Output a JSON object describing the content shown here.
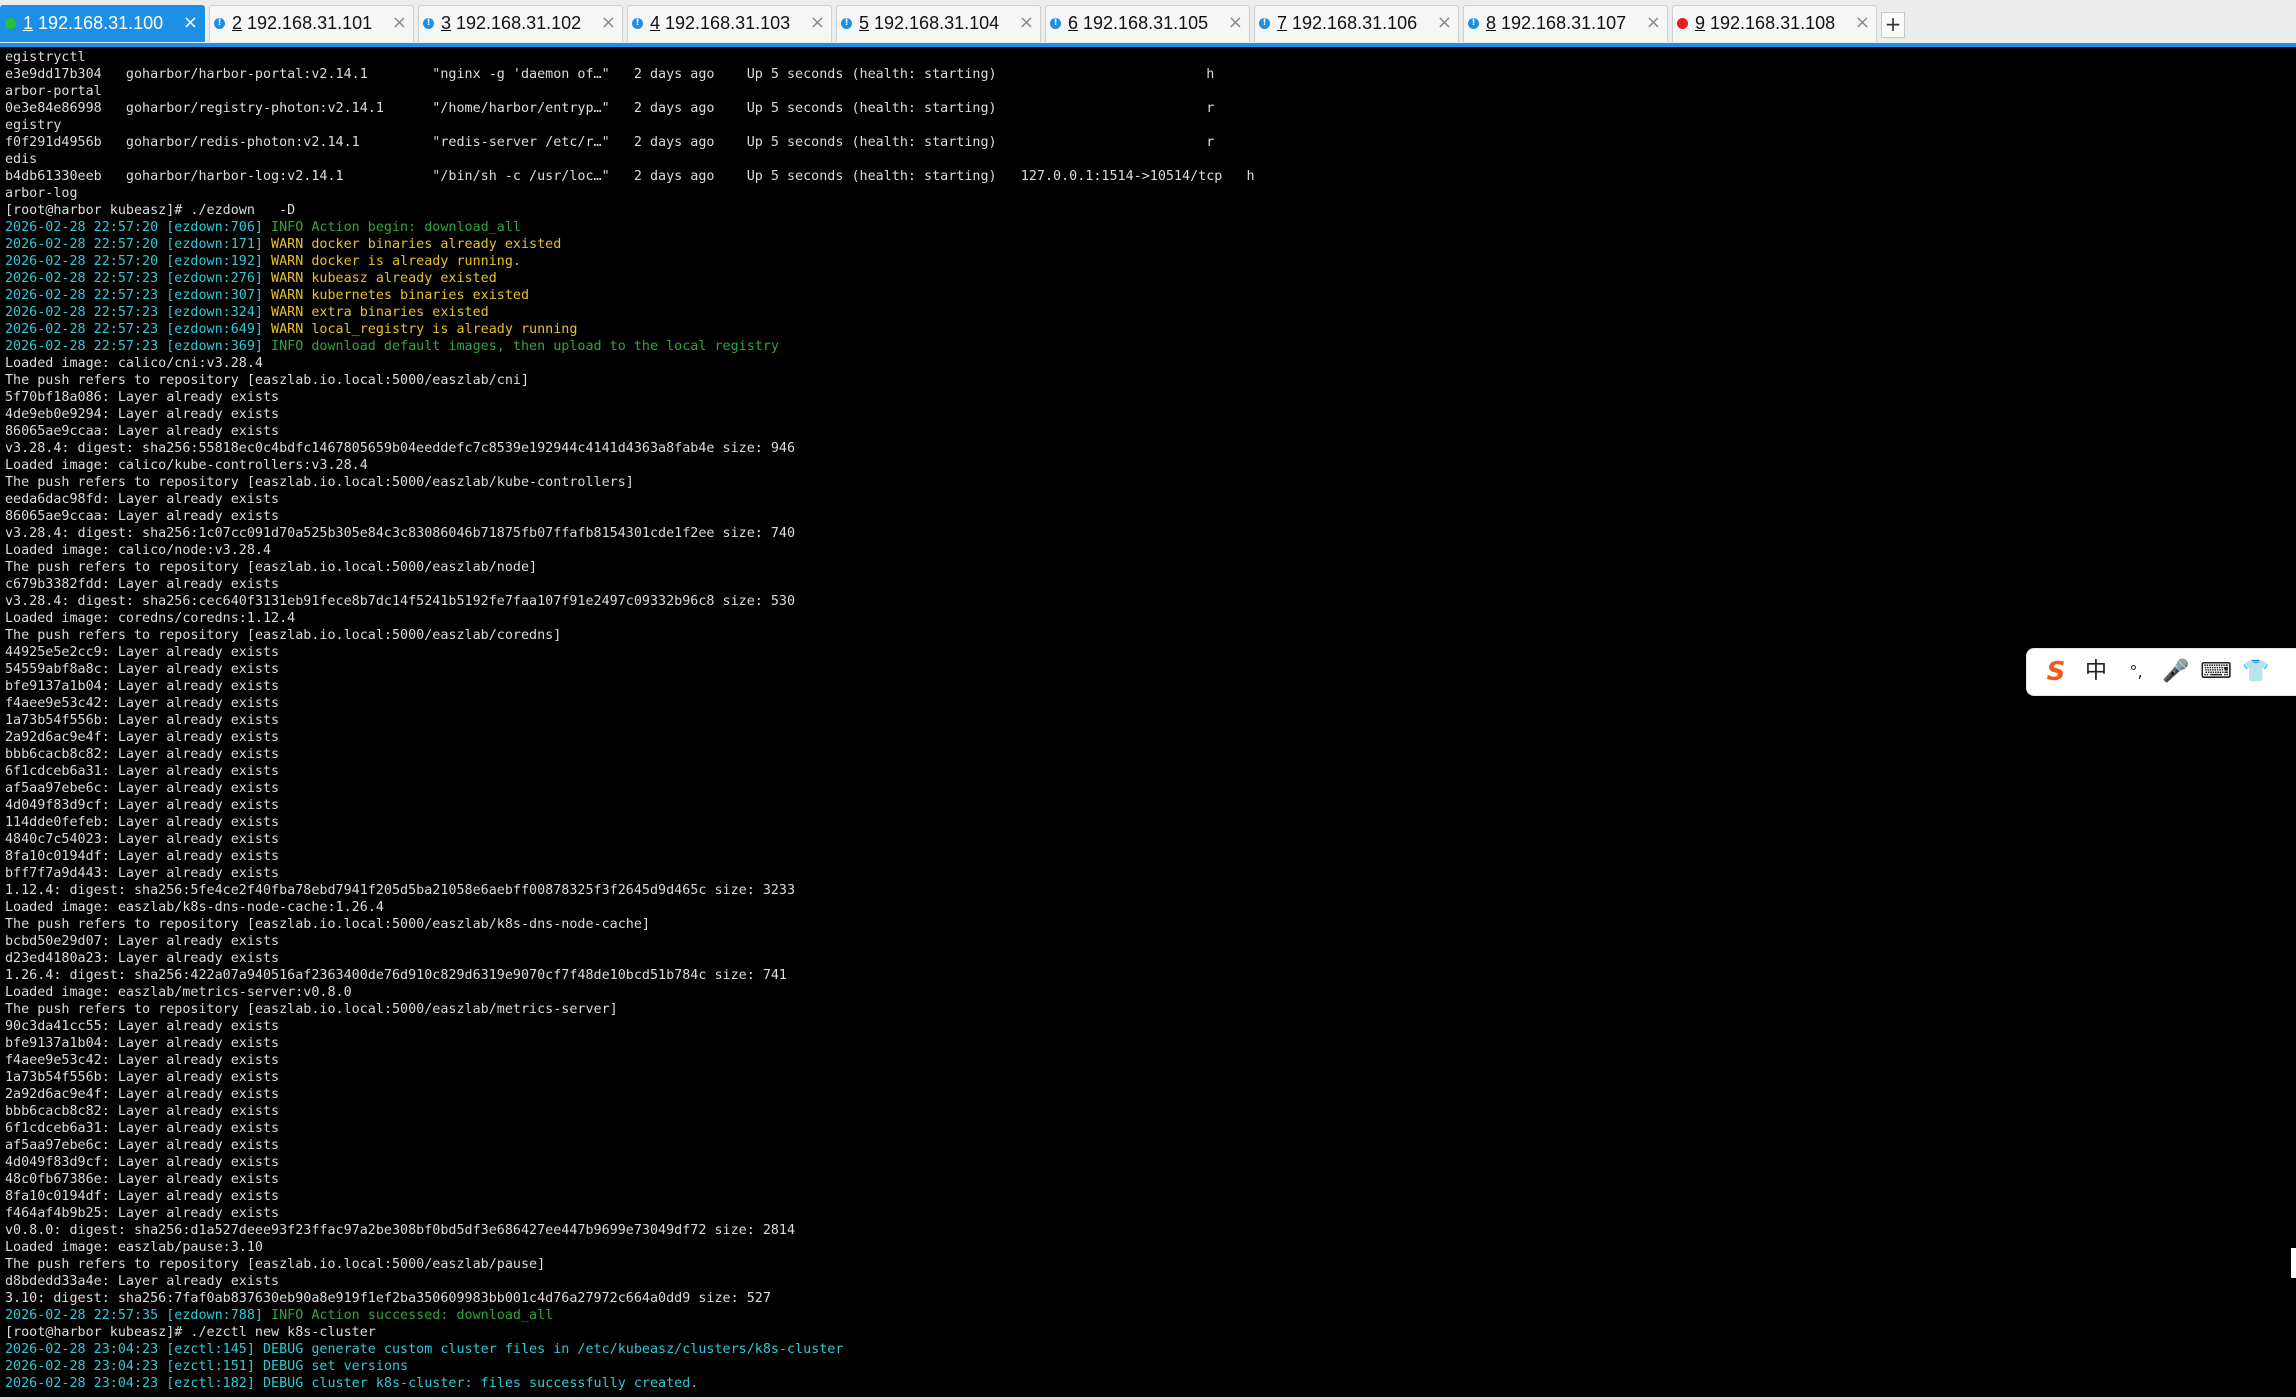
{
  "tabs": [
    {
      "num": "1",
      "host": "192.168.31.100",
      "status": "connected",
      "active": true
    },
    {
      "num": "2",
      "host": "192.168.31.101",
      "status": "warning",
      "active": false
    },
    {
      "num": "3",
      "host": "192.168.31.102",
      "status": "warning",
      "active": false
    },
    {
      "num": "4",
      "host": "192.168.31.103",
      "status": "warning",
      "active": false
    },
    {
      "num": "5",
      "host": "192.168.31.104",
      "status": "warning",
      "active": false
    },
    {
      "num": "6",
      "host": "192.168.31.105",
      "status": "warning",
      "active": false
    },
    {
      "num": "7",
      "host": "192.168.31.106",
      "status": "warning",
      "active": false
    },
    {
      "num": "8",
      "host": "192.168.31.107",
      "status": "warning",
      "active": false
    },
    {
      "num": "9",
      "host": "192.168.31.108",
      "status": "disconnected",
      "active": false
    }
  ],
  "tab_close_glyph": "×",
  "new_tab_glyph": "+",
  "colors": {
    "tab_active": "#1e8fe6",
    "status_connected": "#2ebd3b",
    "status_warning": "#1e8fe6",
    "status_disconnected": "#e02020",
    "terminal_bg": "#000000",
    "log_timestamp": "#2fc9d6",
    "log_info": "#2fa53a",
    "log_warn": "#e6c12a"
  },
  "terminal": {
    "lines": [
      [
        {
          "t": "egistryctl"
        }
      ],
      [
        {
          "t": "e3e9dd17b304   goharbor/harbor-portal:v2.14.1        \"nginx -g 'daemon of…\"   2 days ago    Up 5 seconds (health: starting)                          h"
        }
      ],
      [
        {
          "t": "arbor-portal"
        }
      ],
      [
        {
          "t": "0e3e84e86998   goharbor/registry-photon:v2.14.1      \"/home/harbor/entryp…\"   2 days ago    Up 5 seconds (health: starting)                          r"
        }
      ],
      [
        {
          "t": "egistry"
        }
      ],
      [
        {
          "t": "f0f291d4956b   goharbor/redis-photon:v2.14.1         \"redis-server /etc/r…\"   2 days ago    Up 5 seconds (health: starting)                          r"
        }
      ],
      [
        {
          "t": "edis"
        }
      ],
      [
        {
          "t": "b4db61330eeb   goharbor/harbor-log:v2.14.1           \"/bin/sh -c /usr/loc…\"   2 days ago    Up 5 seconds (health: starting)   127.0.0.1:1514->10514/tcp   h"
        }
      ],
      [
        {
          "t": "arbor-log"
        }
      ],
      [
        {
          "t": "[root@harbor kubeasz]# ./ezdown   -D"
        }
      ],
      [
        {
          "t": "2026-02-28 22:57:20 [ezdown:706] ",
          "c": "ts"
        },
        {
          "t": "INFO Action begin: download_all",
          "c": "info"
        }
      ],
      [
        {
          "t": "2026-02-28 22:57:20 [ezdown:171] ",
          "c": "ts"
        },
        {
          "t": "WARN docker binaries already existed",
          "c": "warn"
        }
      ],
      [
        {
          "t": "2026-02-28 22:57:20 [ezdown:192] ",
          "c": "ts"
        },
        {
          "t": "WARN docker is already running.",
          "c": "warn"
        }
      ],
      [
        {
          "t": "2026-02-28 22:57:23 [ezdown:276] ",
          "c": "ts"
        },
        {
          "t": "WARN kubeasz already existed",
          "c": "warn"
        }
      ],
      [
        {
          "t": "2026-02-28 22:57:23 [ezdown:307] ",
          "c": "ts"
        },
        {
          "t": "WARN kubernetes binaries existed",
          "c": "warn"
        }
      ],
      [
        {
          "t": "2026-02-28 22:57:23 [ezdown:324] ",
          "c": "ts"
        },
        {
          "t": "WARN extra binaries existed",
          "c": "warn"
        }
      ],
      [
        {
          "t": "2026-02-28 22:57:23 [ezdown:649] ",
          "c": "ts"
        },
        {
          "t": "WARN local_registry is already running",
          "c": "warn"
        }
      ],
      [
        {
          "t": "2026-02-28 22:57:23 [ezdown:369] ",
          "c": "ts"
        },
        {
          "t": "INFO download default images, then upload to the local registry",
          "c": "info"
        }
      ],
      [
        {
          "t": "Loaded image: calico/cni:v3.28.4"
        }
      ],
      [
        {
          "t": "The push refers to repository [easzlab.io.local:5000/easzlab/cni]"
        }
      ],
      [
        {
          "t": "5f70bf18a086: Layer already exists"
        }
      ],
      [
        {
          "t": "4de9eb0e9294: Layer already exists"
        }
      ],
      [
        {
          "t": "86065ae9ccaa: Layer already exists"
        }
      ],
      [
        {
          "t": "v3.28.4: digest: sha256:55818ec0c4bdfc1467805659b04eeddefc7c8539e192944c4141d4363a8fab4e size: 946"
        }
      ],
      [
        {
          "t": "Loaded image: calico/kube-controllers:v3.28.4"
        }
      ],
      [
        {
          "t": "The push refers to repository [easzlab.io.local:5000/easzlab/kube-controllers]"
        }
      ],
      [
        {
          "t": "eeda6dac98fd: Layer already exists"
        }
      ],
      [
        {
          "t": "86065ae9ccaa: Layer already exists"
        }
      ],
      [
        {
          "t": "v3.28.4: digest: sha256:1c07cc091d70a525b305e84c3c83086046b71875fb07ffafb8154301cde1f2ee size: 740"
        }
      ],
      [
        {
          "t": "Loaded image: calico/node:v3.28.4"
        }
      ],
      [
        {
          "t": "The push refers to repository [easzlab.io.local:5000/easzlab/node]"
        }
      ],
      [
        {
          "t": "c679b3382fdd: Layer already exists"
        }
      ],
      [
        {
          "t": "v3.28.4: digest: sha256:cec640f3131eb91fece8b7dc14f5241b5192fe7faa107f91e2497c09332b96c8 size: 530"
        }
      ],
      [
        {
          "t": "Loaded image: coredns/coredns:1.12.4"
        }
      ],
      [
        {
          "t": "The push refers to repository [easzlab.io.local:5000/easzlab/coredns]"
        }
      ],
      [
        {
          "t": "44925e5e2cc9: Layer already exists"
        }
      ],
      [
        {
          "t": "54559abf8a8c: Layer already exists"
        }
      ],
      [
        {
          "t": "bfe9137a1b04: Layer already exists"
        }
      ],
      [
        {
          "t": "f4aee9e53c42: Layer already exists"
        }
      ],
      [
        {
          "t": "1a73b54f556b: Layer already exists"
        }
      ],
      [
        {
          "t": "2a92d6ac9e4f: Layer already exists"
        }
      ],
      [
        {
          "t": "bbb6cacb8c82: Layer already exists"
        }
      ],
      [
        {
          "t": "6f1cdceb6a31: Layer already exists"
        }
      ],
      [
        {
          "t": "af5aa97ebe6c: Layer already exists"
        }
      ],
      [
        {
          "t": "4d049f83d9cf: Layer already exists"
        }
      ],
      [
        {
          "t": "114dde0fefeb: Layer already exists"
        }
      ],
      [
        {
          "t": "4840c7c54023: Layer already exists"
        }
      ],
      [
        {
          "t": "8fa10c0194df: Layer already exists"
        }
      ],
      [
        {
          "t": "bff7f7a9d443: Layer already exists"
        }
      ],
      [
        {
          "t": "1.12.4: digest: sha256:5fe4ce2f40fba78ebd7941f205d5ba21058e6aebff00878325f3f2645d9d465c size: 3233"
        }
      ],
      [
        {
          "t": "Loaded image: easzlab/k8s-dns-node-cache:1.26.4"
        }
      ],
      [
        {
          "t": "The push refers to repository [easzlab.io.local:5000/easzlab/k8s-dns-node-cache]"
        }
      ],
      [
        {
          "t": "bcbd50e29d07: Layer already exists"
        }
      ],
      [
        {
          "t": "d23ed4180a23: Layer already exists"
        }
      ],
      [
        {
          "t": "1.26.4: digest: sha256:422a07a940516af2363400de76d910c829d6319e9070cf7f48de10bcd51b784c size: 741"
        }
      ],
      [
        {
          "t": "Loaded image: easzlab/metrics-server:v0.8.0"
        }
      ],
      [
        {
          "t": "The push refers to repository [easzlab.io.local:5000/easzlab/metrics-server]"
        }
      ],
      [
        {
          "t": "90c3da41cc55: Layer already exists"
        }
      ],
      [
        {
          "t": "bfe9137a1b04: Layer already exists"
        }
      ],
      [
        {
          "t": "f4aee9e53c42: Layer already exists"
        }
      ],
      [
        {
          "t": "1a73b54f556b: Layer already exists"
        }
      ],
      [
        {
          "t": "2a92d6ac9e4f: Layer already exists"
        }
      ],
      [
        {
          "t": "bbb6cacb8c82: Layer already exists"
        }
      ],
      [
        {
          "t": "6f1cdceb6a31: Layer already exists"
        }
      ],
      [
        {
          "t": "af5aa97ebe6c: Layer already exists"
        }
      ],
      [
        {
          "t": "4d049f83d9cf: Layer already exists"
        }
      ],
      [
        {
          "t": "48c0fb67386e: Layer already exists"
        }
      ],
      [
        {
          "t": "8fa10c0194df: Layer already exists"
        }
      ],
      [
        {
          "t": "f464af4b9b25: Layer already exists"
        }
      ],
      [
        {
          "t": "v0.8.0: digest: sha256:d1a527deee93f23ffac97a2be308bf0bd5df3e686427ee447b9699e73049df72 size: 2814"
        }
      ],
      [
        {
          "t": "Loaded image: easzlab/pause:3.10"
        }
      ],
      [
        {
          "t": "The push refers to repository [easzlab.io.local:5000/easzlab/pause]"
        }
      ],
      [
        {
          "t": "d8bdedd33a4e: Layer already exists"
        }
      ],
      [
        {
          "t": "3.10: digest: sha256:7faf0ab837630eb90a8e919f1ef2ba350609983bb001c4d76a27972c664a0dd9 size: 527"
        }
      ],
      [
        {
          "t": "2026-02-28 22:57:35 [ezdown:788] ",
          "c": "ts"
        },
        {
          "t": "INFO Action successed: download_all",
          "c": "info"
        }
      ],
      [
        {
          "t": "[root@harbor kubeasz]# ./ezctl new k8s-cluster"
        }
      ],
      [
        {
          "t": "2026-02-28 23:04:23 [ezctl:145] DEBUG generate custom cluster files in /etc/kubeasz/clusters/k8s-cluster",
          "c": "debug"
        }
      ],
      [
        {
          "t": "2026-02-28 23:04:23 [ezctl:151] DEBUG set versions",
          "c": "debug"
        }
      ],
      [
        {
          "t": "2026-02-28 23:04:23 [ezctl:182] DEBUG cluster k8s-cluster: files successfully created.",
          "c": "debug"
        }
      ]
    ]
  },
  "ime": {
    "buttons": [
      {
        "name": "sogou-logo-icon",
        "glyph": "S"
      },
      {
        "name": "chinese-mode-toggle",
        "glyph": "中"
      },
      {
        "name": "punctuation-toggle",
        "glyph": "°,"
      },
      {
        "name": "microphone-icon",
        "glyph": "🎤"
      },
      {
        "name": "keyboard-icon",
        "glyph": "⌨"
      },
      {
        "name": "skin-shirt-icon",
        "glyph": "👕"
      }
    ]
  }
}
